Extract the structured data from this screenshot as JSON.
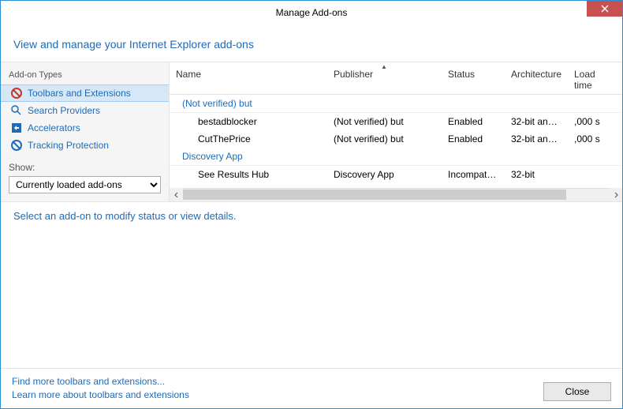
{
  "window": {
    "title": "Manage Add-ons"
  },
  "header": {
    "title": "View and manage your Internet Explorer add-ons"
  },
  "sidebar": {
    "types_label": "Add-on Types",
    "items": [
      {
        "label": "Toolbars and Extensions"
      },
      {
        "label": "Search Providers"
      },
      {
        "label": "Accelerators"
      },
      {
        "label": "Tracking Protection"
      }
    ],
    "show_label": "Show:",
    "show_value": "Currently loaded add-ons"
  },
  "grid": {
    "columns": {
      "name": "Name",
      "publisher": "Publisher",
      "status": "Status",
      "architecture": "Architecture",
      "load_time": "Load time"
    },
    "groups": [
      {
        "label": "(Not verified) but",
        "rows": [
          {
            "name": "bestadblocker",
            "publisher": "(Not verified) but",
            "status": "Enabled",
            "architecture": "32-bit and ...",
            "load_time": ",000 s"
          },
          {
            "name": "CutThePrice",
            "publisher": "(Not verified) but",
            "status": "Enabled",
            "architecture": "32-bit and ...",
            "load_time": ",000 s"
          }
        ]
      },
      {
        "label": "Discovery App",
        "rows": [
          {
            "name": "See Results Hub",
            "publisher": "Discovery App",
            "status": "Incompatible",
            "architecture": "32-bit",
            "load_time": ""
          }
        ]
      }
    ]
  },
  "detail": {
    "message": "Select an add-on to modify status or view details."
  },
  "footer": {
    "link_find": "Find more toolbars and extensions...",
    "link_learn": "Learn more about toolbars and extensions",
    "close_label": "Close"
  }
}
